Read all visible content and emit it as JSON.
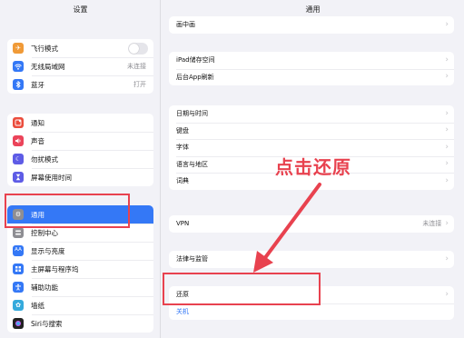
{
  "sidebar": {
    "title": "设置",
    "groups": [
      [
        {
          "label": "飞行模式",
          "icon": "airplane-icon",
          "color": "#f09a37",
          "control": "toggle",
          "value": ""
        },
        {
          "label": "无线局域网",
          "icon": "wifi-icon",
          "color": "#3478f6",
          "value": "未连接"
        },
        {
          "label": "蓝牙",
          "icon": "bluetooth-icon",
          "color": "#3478f6",
          "value": "打开"
        }
      ],
      [
        {
          "label": "通知",
          "icon": "notification-icon",
          "color": "#eb4d3d"
        },
        {
          "label": "声音",
          "icon": "speaker-icon",
          "color": "#eb445a"
        },
        {
          "label": "勿扰模式",
          "icon": "moon-icon",
          "color": "#5e5ce6"
        },
        {
          "label": "屏幕使用时间",
          "icon": "hourglass-icon",
          "color": "#5e5ce6"
        }
      ],
      [
        {
          "label": "通用",
          "icon": "gear-icon",
          "color": "#8e8e93",
          "selected": true
        },
        {
          "label": "控制中心",
          "icon": "control-center-icon",
          "color": "#8e8e93"
        },
        {
          "label": "显示与亮度",
          "icon": "display-icon",
          "color": "#3478f6"
        },
        {
          "label": "主屏幕与程序坞",
          "icon": "home-screen-icon",
          "color": "#3478f6"
        },
        {
          "label": "辅助功能",
          "icon": "accessibility-icon",
          "color": "#3478f6"
        },
        {
          "label": "墙纸",
          "icon": "wallpaper-icon",
          "color": "#35aadc"
        },
        {
          "label": "Siri与搜索",
          "icon": "siri-icon",
          "color": "#222222"
        }
      ]
    ]
  },
  "main": {
    "title": "通用",
    "groups": [
      [
        {
          "label": "画中画"
        }
      ],
      [
        {
          "label": "iPad储存空间"
        },
        {
          "label": "后台App刷新"
        }
      ],
      [
        {
          "label": "日期与时间"
        },
        {
          "label": "键盘"
        },
        {
          "label": "字体"
        },
        {
          "label": "语言与地区"
        },
        {
          "label": "词典"
        }
      ],
      [
        {
          "label": "VPN",
          "value": "未连接"
        }
      ],
      [
        {
          "label": "法律与监管"
        }
      ],
      [
        {
          "label": "还原"
        },
        {
          "label": "关机",
          "style": "blue"
        }
      ]
    ]
  },
  "annotation": {
    "text": "点击还原",
    "color": "#e8424f"
  }
}
